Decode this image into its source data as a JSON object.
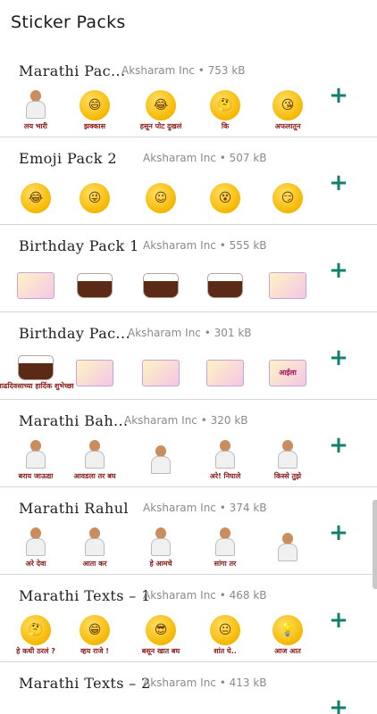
{
  "app": {
    "title": "Sticker Packs"
  },
  "colors": {
    "accent": "#13806f",
    "divider": "#d6d6d6",
    "meta": "#8a8a8a"
  },
  "add_icon": "+",
  "packs": [
    {
      "name": "Marathi Pac...",
      "meta": "Aksharam Inc • 753 kB",
      "stickers": [
        {
          "icon": "turban-person",
          "glyph": "☺",
          "caption": "लय भारी"
        },
        {
          "icon": "grin-emoji",
          "glyph": "😄",
          "caption": "झक्कास"
        },
        {
          "icon": "laugh-cry-emoji",
          "glyph": "😂",
          "caption": "हसून पोट दुखलं"
        },
        {
          "icon": "thinking-emoji",
          "glyph": "🤔",
          "caption": "कि"
        },
        {
          "icon": "kiss-emoji",
          "glyph": "😘",
          "caption": "अफलातून"
        }
      ]
    },
    {
      "name": "Emoji Pack 2",
      "meta": "Aksharam Inc • 507 kB",
      "stickers": [
        {
          "icon": "laugh-cry-emoji",
          "glyph": "😂",
          "caption": ""
        },
        {
          "icon": "crazy-emoji",
          "glyph": "😜",
          "caption": ""
        },
        {
          "icon": "shy-emoji",
          "glyph": "☺",
          "caption": ""
        },
        {
          "icon": "dizzy-emoji",
          "glyph": "😵",
          "caption": ""
        },
        {
          "icon": "smirk-emoji",
          "glyph": "😏",
          "caption": ""
        }
      ]
    },
    {
      "name": "Birthday Pack 1",
      "meta": "Aksharam Inc • 555 kB",
      "stickers": [
        {
          "icon": "birthday-card",
          "glyph": "",
          "caption": ""
        },
        {
          "icon": "cake",
          "glyph": "",
          "caption": ""
        },
        {
          "icon": "cake",
          "glyph": "",
          "caption": ""
        },
        {
          "icon": "cake",
          "glyph": "",
          "caption": ""
        },
        {
          "icon": "birthday-card",
          "glyph": "",
          "caption": ""
        }
      ]
    },
    {
      "name": "Birthday Pac...",
      "meta": "Aksharam Inc • 301 kB",
      "stickers": [
        {
          "icon": "cake",
          "glyph": "",
          "caption": "वाढदिवसाच्या हार्दिक शुभेच्छा"
        },
        {
          "icon": "birthday-card",
          "glyph": "",
          "caption": ""
        },
        {
          "icon": "birthday-card",
          "glyph": "",
          "caption": ""
        },
        {
          "icon": "birthday-card",
          "glyph": "",
          "caption": ""
        },
        {
          "icon": "birthday-card",
          "glyph": "आईला",
          "caption": ""
        }
      ]
    },
    {
      "name": "Marathi Bah...",
      "meta": "Aksharam Inc • 320 kB",
      "stickers": [
        {
          "icon": "person",
          "glyph": "",
          "caption": "बराय जाऊद्या"
        },
        {
          "icon": "person",
          "glyph": "",
          "caption": "आवडला तर बघ"
        },
        {
          "icon": "person",
          "glyph": "",
          "caption": ""
        },
        {
          "icon": "person",
          "glyph": "",
          "caption": "अरे! निघाले"
        },
        {
          "icon": "person",
          "glyph": "",
          "caption": "किस्से तुझे"
        }
      ]
    },
    {
      "name": "Marathi Rahul",
      "meta": "Aksharam Inc • 374 kB",
      "stickers": [
        {
          "icon": "person",
          "glyph": "",
          "caption": "अरे देवा"
        },
        {
          "icon": "person",
          "glyph": "",
          "caption": "आता कर"
        },
        {
          "icon": "person",
          "glyph": "",
          "caption": "हे आमचे"
        },
        {
          "icon": "person",
          "glyph": "",
          "caption": "सांगा तर"
        },
        {
          "icon": "person",
          "glyph": "",
          "caption": ""
        }
      ]
    },
    {
      "name": "Marathi Texts – 1",
      "meta": "Aksharam Inc • 468 kB",
      "stickers": [
        {
          "icon": "thinking-emoji",
          "glyph": "🤔",
          "caption": "हे कधी ठरलं ?"
        },
        {
          "icon": "grin-emoji",
          "glyph": "😁",
          "caption": "व्हय राजे !"
        },
        {
          "icon": "cool-emoji",
          "glyph": "😎",
          "caption": "बसून खात बघ"
        },
        {
          "icon": "neutral-emoji",
          "glyph": "😐",
          "caption": "शांत घे.."
        },
        {
          "icon": "thinking-emoji",
          "glyph": "💡",
          "caption": "आज आत"
        }
      ]
    },
    {
      "name": "Marathi Texts – 2",
      "meta": "Aksharam Inc • 413 kB",
      "stickers": []
    }
  ]
}
